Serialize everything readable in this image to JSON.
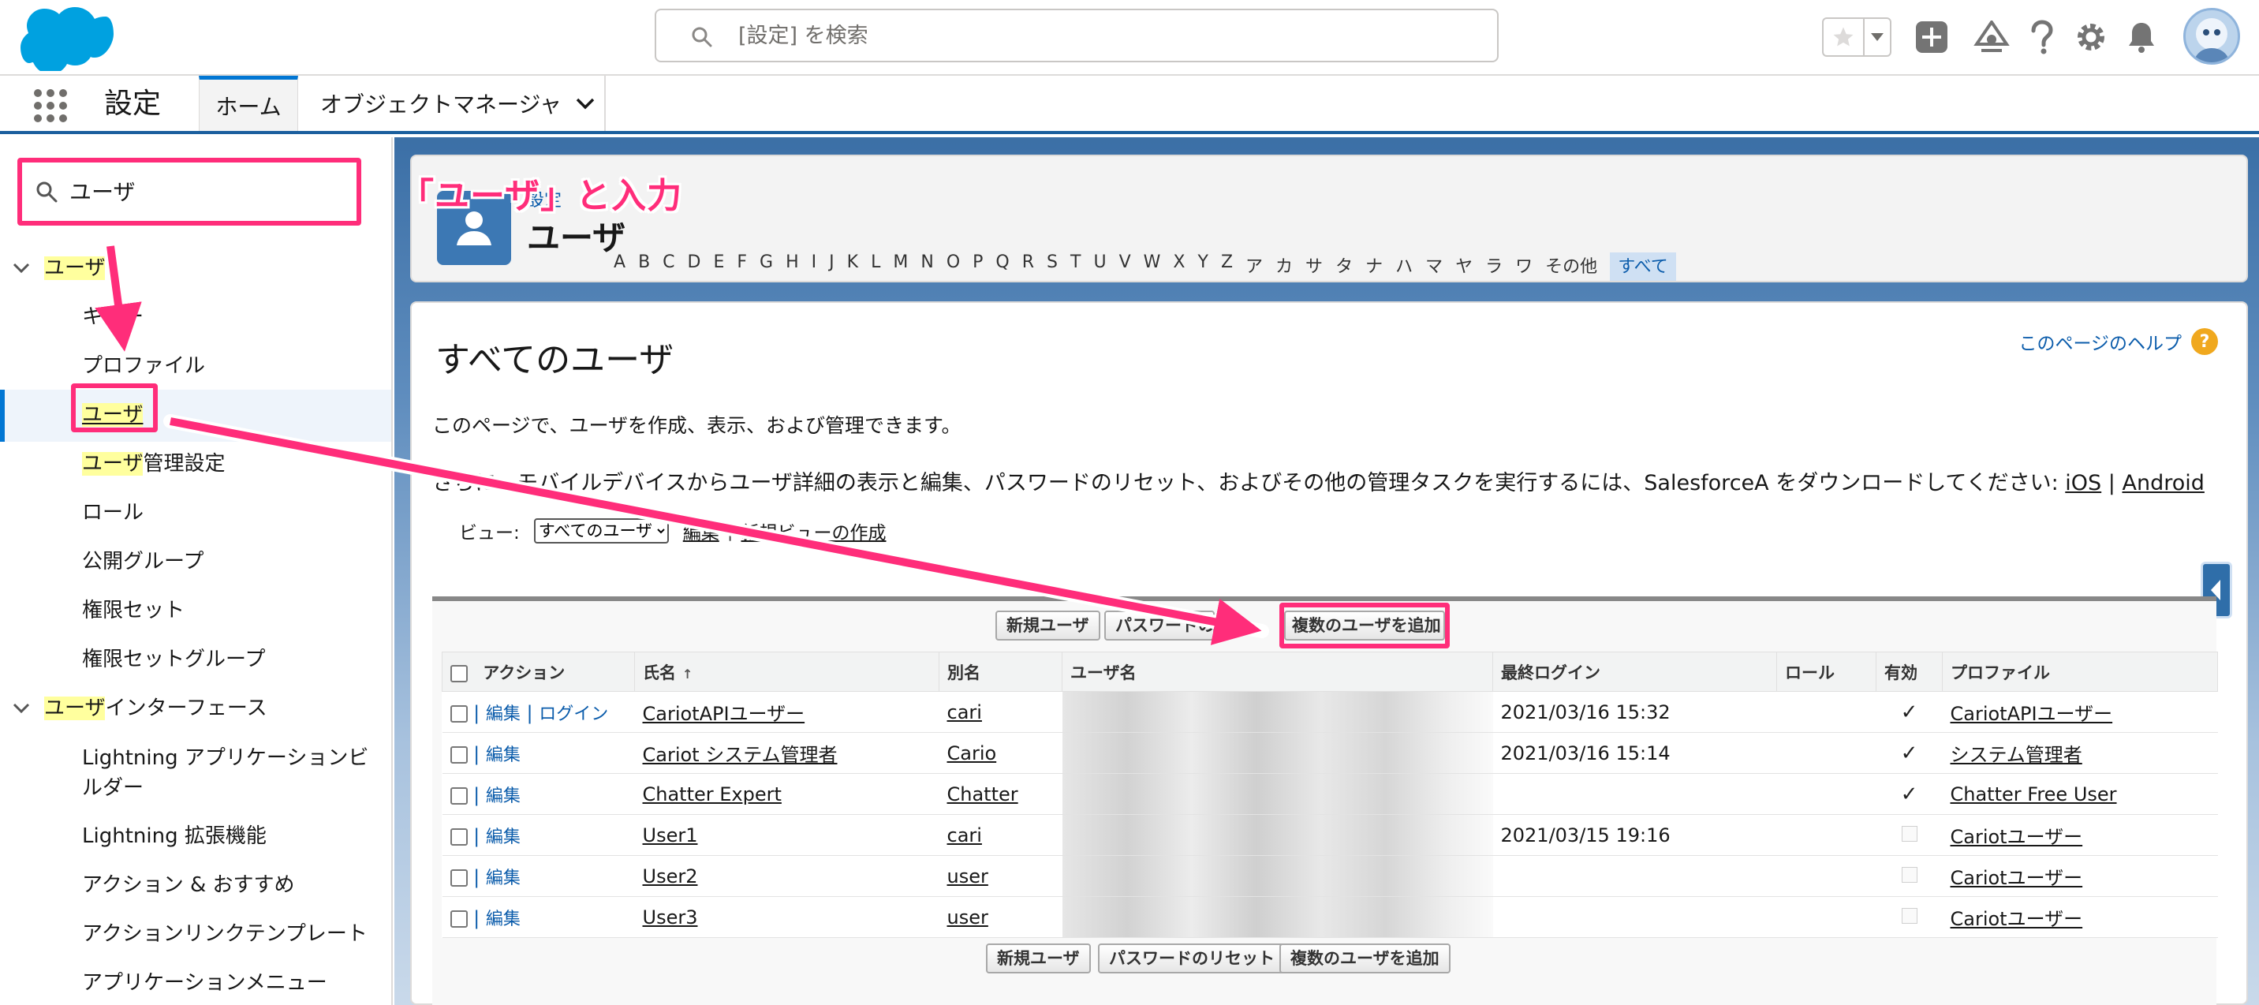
{
  "header": {
    "search_placeholder": "[設定] を検索",
    "icons": [
      "salesforce-cloud-logo",
      "search-icon",
      "favorite-star-icon",
      "favorites-menu-icon",
      "global-actions-icon",
      "trailhead-icon",
      "help-icon",
      "setup-gear-icon",
      "notifications-bell-icon",
      "user-avatar"
    ]
  },
  "context_bar": {
    "app_name": "設定",
    "tabs": [
      {
        "label": "ホーム",
        "active": true
      },
      {
        "label": "オブジェクトマネージャ",
        "active": false
      }
    ]
  },
  "sidebar": {
    "quickfind_value": "ユーザ",
    "items": [
      {
        "label_hl": "ユーザ",
        "label_rest": "",
        "level": 1,
        "expanded": true
      },
      {
        "label_hl": "",
        "label_rest": "キュー",
        "level": 2
      },
      {
        "label_hl": "",
        "label_rest": "プロファイル",
        "level": 2
      },
      {
        "label_hl": "ユーザ",
        "label_rest": "",
        "level": 2,
        "selected": true
      },
      {
        "label_hl": "ユーザ",
        "label_rest": "管理設定",
        "level": 2
      },
      {
        "label_hl": "",
        "label_rest": "ロール",
        "level": 2
      },
      {
        "label_hl": "",
        "label_rest": "公開グループ",
        "level": 2
      },
      {
        "label_hl": "",
        "label_rest": "権限セット",
        "level": 2
      },
      {
        "label_hl": "",
        "label_rest": "権限セットグループ",
        "level": 2
      },
      {
        "label_hl": "ユーザ",
        "label_rest": "インターフェース",
        "level": 1,
        "expanded": true
      },
      {
        "label_hl": "",
        "label_rest": "Lightning アプリケーションビルダー",
        "level": 2
      },
      {
        "label_hl": "",
        "label_rest": "Lightning 拡張機能",
        "level": 2
      },
      {
        "label_hl": "",
        "label_rest": "アクション & おすすめ",
        "level": 2
      },
      {
        "label_hl": "",
        "label_rest": "アクションリンクテンプレート",
        "level": 2
      },
      {
        "label_hl": "",
        "label_rest": "アプリケーションメニュー",
        "level": 2
      }
    ]
  },
  "page_header": {
    "breadcrumb": "設定",
    "title": "ユーザ"
  },
  "annotation": {
    "text": "「ユーザ」と入力",
    "color": "#ff2d7a"
  },
  "content": {
    "title": "すべてのユーザ",
    "help_link": "このページのヘルプ",
    "desc1": "このページで、ユーザを作成、表示、および管理できます。",
    "desc2": "さらに、モバイルデバイスからユーザ詳細の表示と編集、パスワードのリセット、およびその他の管理タスクを実行するには、SalesforceA をダウンロードしてください:",
    "link_ios": "iOS",
    "link_sep": "|",
    "link_android": "Android",
    "view_label": "ビュー:",
    "view_selected": "すべてのユーザ",
    "view_edit": "編集",
    "view_sep": "|",
    "view_new": "新規ビューの作成",
    "alphabet": [
      "A",
      "B",
      "C",
      "D",
      "E",
      "F",
      "G",
      "H",
      "I",
      "J",
      "K",
      "L",
      "M",
      "N",
      "O",
      "P",
      "Q",
      "R",
      "S",
      "T",
      "U",
      "V",
      "W",
      "X",
      "Y",
      "Z",
      "ア",
      "カ",
      "サ",
      "タ",
      "ナ",
      "ハ",
      "マ",
      "ヤ",
      "ラ",
      "ワ",
      "その他",
      "すべて"
    ],
    "buttons": {
      "new_user": "新規ユーザ",
      "reset_password": "パスワードのリセット",
      "add_multiple": "複数のユーザを追加"
    },
    "columns": {
      "action": "アクション",
      "name": "氏名",
      "alias": "別名",
      "username": "ユーザ名",
      "last_login": "最終ログイン",
      "role": "ロール",
      "active": "有効",
      "profile": "プロファイル"
    },
    "action_edit": "編集",
    "action_login": "ログイン",
    "action_sep": "|",
    "rows": [
      {
        "name": "CariotAPIユーザー",
        "alias": "cari",
        "last_login": "2021/03/16 15:32",
        "role": "",
        "active": true,
        "profile": "CariotAPIユーザー",
        "login": true
      },
      {
        "name": "Cariot システム管理者",
        "alias": "Cario",
        "last_login": "2021/03/16 15:14",
        "role": "",
        "active": true,
        "profile": "システム管理者",
        "login": false
      },
      {
        "name": "Chatter Expert",
        "alias": "Chatter",
        "last_login": "",
        "role": "",
        "active": true,
        "profile": "Chatter Free User",
        "login": false
      },
      {
        "name": "User1",
        "alias": "cari",
        "last_login": "2021/03/15 19:16",
        "role": "",
        "active": false,
        "profile": "Cariotユーザー",
        "login": false
      },
      {
        "name": "User2",
        "alias": "user",
        "last_login": "",
        "role": "",
        "active": false,
        "profile": "Cariotユーザー",
        "login": false
      },
      {
        "name": "User3",
        "alias": "user",
        "last_login": "",
        "role": "",
        "active": false,
        "profile": "Cariotユーザー",
        "login": false
      }
    ]
  }
}
